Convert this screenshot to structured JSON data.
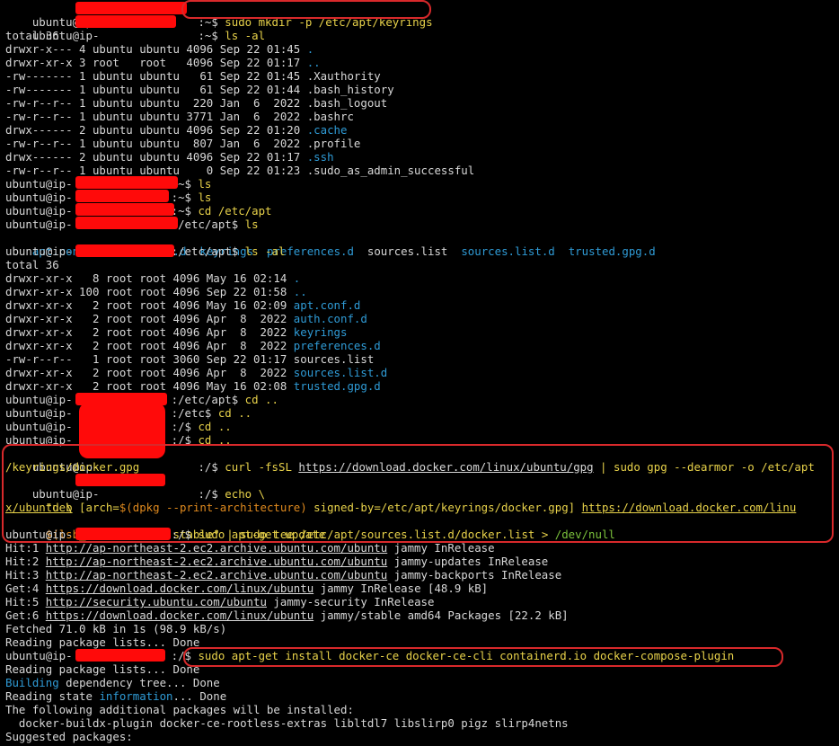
{
  "term": {
    "L0": [
      "ubuntu@ip-",
      ":~$ ",
      "sudo mkdir -p /etc/apt/keyrings"
    ],
    "L1": [
      "ubuntu@ip-",
      ":~$ ",
      "ls -al"
    ],
    "L2": "total 36",
    "L3": [
      "drwxr-x--- 4 ubuntu ubuntu 4096 Sep 22 01:45 ",
      "."
    ],
    "L4": [
      "drwxr-xr-x 3 root   root   4096 Sep 22 01:17 ",
      ".."
    ],
    "L5": [
      "-rw------- 1 ubuntu ubuntu   61 Sep 22 01:45 ",
      ".Xauthority"
    ],
    "L6": [
      "-rw------- 1 ubuntu ubuntu   61 Sep 22 01:44 ",
      ".bash_history"
    ],
    "L7": [
      "-rw-r--r-- 1 ubuntu ubuntu  220 Jan  6  2022 ",
      ".bash_logout"
    ],
    "L8": [
      "-rw-r--r-- 1 ubuntu ubuntu 3771 Jan  6  2022 ",
      ".bashrc"
    ],
    "L9": [
      "drwx------ 2 ubuntu ubuntu 4096 Sep 22 01:20 ",
      ".cache"
    ],
    "L10": [
      "-rw-r--r-- 1 ubuntu ubuntu  807 Jan  6  2022 ",
      ".profile"
    ],
    "L11": [
      "drwx------ 2 ubuntu ubuntu 4096 Sep 22 01:17 ",
      ".ssh"
    ],
    "L12": [
      "-rw-r--r-- 1 ubuntu ubuntu    0 Sep 22 01:23 ",
      ".sudo_as_admin_successful"
    ],
    "L13": [
      "ubuntu@ip-",
      ":~$ ",
      "ls"
    ],
    "L14": [
      "ubuntu@ip-",
      ":~$ ",
      "ls"
    ],
    "L15": [
      "ubuntu@ip-",
      ":~$ ",
      "cd /etc/apt"
    ],
    "L16": [
      "ubuntu@ip-",
      ":/etc/apt$ ",
      "ls"
    ],
    "L17": [
      "apt.conf.d",
      "  ",
      "auth.conf.d",
      "  ",
      "keyrings",
      "  ",
      "preferences.d",
      "  ",
      "sources.list",
      "  ",
      "sources.list.d",
      "  ",
      "trusted.gpg.d"
    ],
    "L18": [
      "ubuntu@ip-",
      ":/etc/apt$ ",
      "ls -al"
    ],
    "L19": "total 36",
    "L20": [
      "drwxr-xr-x   8 root root 4096 May 16 02:14 ",
      "."
    ],
    "L21": [
      "drwxr-xr-x 100 root root 4096 Sep 22 01:58 ",
      ".."
    ],
    "L22": [
      "drwxr-xr-x   2 root root 4096 May 16 02:09 ",
      "apt.conf.d"
    ],
    "L23": [
      "drwxr-xr-x   2 root root 4096 Apr  8  2022 ",
      "auth.conf.d"
    ],
    "L24": [
      "drwxr-xr-x   2 root root 4096 Apr  8  2022 ",
      "keyrings"
    ],
    "L25": [
      "drwxr-xr-x   2 root root 4096 Apr  8  2022 ",
      "preferences.d"
    ],
    "L26": [
      "-rw-r--r--   1 root root 3060 Sep 22 01:17 ",
      "sources.list"
    ],
    "L27": [
      "drwxr-xr-x   2 root root 4096 Apr  8  2022 ",
      "sources.list.d"
    ],
    "L28": [
      "drwxr-xr-x   2 root root 4096 May 16 02:08 ",
      "trusted.gpg.d"
    ],
    "L29": [
      "ubuntu@ip-",
      ":/etc/apt$ ",
      "cd .."
    ],
    "L30": [
      "ubuntu@ip-",
      ":/etc$ ",
      "cd .."
    ],
    "L31": [
      "ubuntu@ip-",
      ":/$ ",
      "cd .."
    ],
    "L32": [
      "ubuntu@ip-",
      ":/$ ",
      "cd .."
    ],
    "L33": [
      "ubuntu@ip-",
      ":/$ ",
      "curl",
      " -fsSL ",
      "https://download.docker.com/linux/ubuntu/gpg",
      " | ",
      "sudo gpg",
      " --dearmor -o /etc/apt"
    ],
    "L34": "/keyrings/docker.gpg",
    "L35": [
      "ubuntu@ip-",
      ":/$ ",
      "echo",
      " \\"
    ],
    "L36": [
      "  \"deb [arch=",
      "$(",
      "dpkg --print-architecture",
      ")",
      " signed-by=/etc/apt/keyrings/docker.gpg] ",
      "https://download.docker.com/linu"
    ],
    "L37": "x/ubuntu \\",
    "L38": [
      "  ",
      "$(",
      "lsb_release -cs",
      ")",
      " stable\" | ",
      "sudo tee",
      " /etc/apt/sources.list.d/docker.list > ",
      "/dev/null"
    ],
    "L39": [
      "ubuntu@ip-",
      ":/$ ",
      "sudo apt-get update"
    ],
    "L40": [
      "Hit:1 ",
      "http://ap-northeast-2.ec2.archive.ubuntu.com/ubuntu",
      " jammy InRelease"
    ],
    "L41": [
      "Hit:2 ",
      "http://ap-northeast-2.ec2.archive.ubuntu.com/ubuntu",
      " jammy-updates InRelease"
    ],
    "L42": [
      "Hit:3 ",
      "http://ap-northeast-2.ec2.archive.ubuntu.com/ubuntu",
      " jammy-backports InRelease"
    ],
    "L43": [
      "Get:4 ",
      "https://download.docker.com/linux/ubuntu",
      " jammy InRelease [48.9 kB]"
    ],
    "L44": [
      "Hit:5 ",
      "http://security.ubuntu.com/ubuntu",
      " jammy-security InRelease"
    ],
    "L45": [
      "Get:6 ",
      "https://download.docker.com/linux/ubuntu",
      " jammy/stable amd64 Packages [22.2 kB]"
    ],
    "L46": "Fetched 71.0 kB in 1s (98.9 kB/s)",
    "L47": "Reading package lists... Done",
    "L48": [
      "ubuntu@ip-",
      ":/$ ",
      "sudo apt-get install docker-ce docker-ce-cli containerd.io docker-compose-plugin"
    ],
    "L49": "Reading package lists... Done",
    "L50": [
      "Building",
      " dependency tree... Done"
    ],
    "L51": [
      "Reading state ",
      "information",
      "... Done"
    ],
    "L52": "The following additional packages will be installed:",
    "L53": "  docker-buildx-plugin docker-ce-rootless-extras libltdl7 libslirp0 pigz slirp4netns",
    "L54": "Suggested packages:"
  },
  "colors": {
    "background": "#000000",
    "text": "#d8d8d8",
    "directory": "#2f9bd6",
    "command": "#e8d24a",
    "string": "#e08a1e",
    "redaction": "#ff0a0a",
    "highlight_box": "#d8292b"
  }
}
